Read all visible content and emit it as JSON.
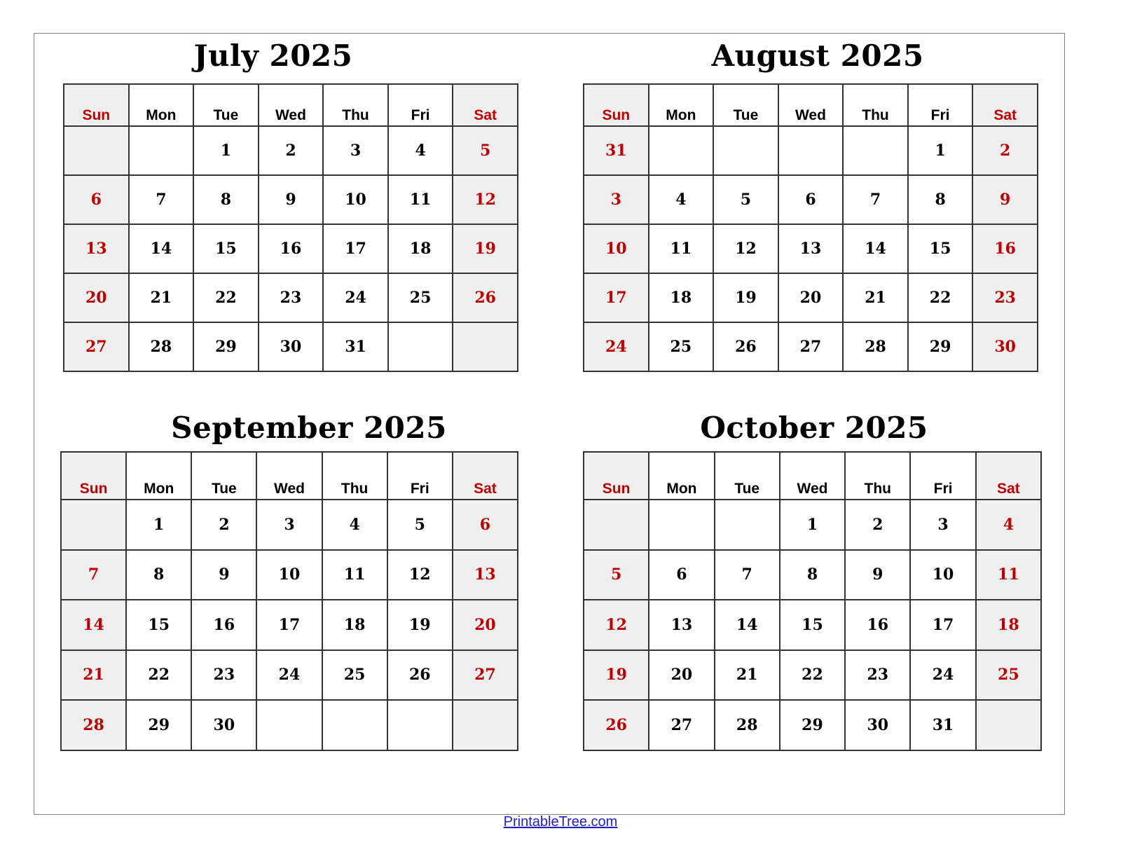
{
  "weekday_headers": [
    "Sun",
    "Mon",
    "Tue",
    "Wed",
    "Thu",
    "Fri",
    "Sat"
  ],
  "colors": {
    "weekend_text": "#c00000",
    "weekend_bg": "#efefef",
    "grid": "#333333",
    "link": "#1f1fcc"
  },
  "months": [
    {
      "title": "July 2025",
      "weeks": [
        [
          "",
          "",
          "1",
          "2",
          "3",
          "4",
          "5"
        ],
        [
          "6",
          "7",
          "8",
          "9",
          "10",
          "11",
          "12"
        ],
        [
          "13",
          "14",
          "15",
          "16",
          "17",
          "18",
          "19"
        ],
        [
          "20",
          "21",
          "22",
          "23",
          "24",
          "25",
          "26"
        ],
        [
          "27",
          "28",
          "29",
          "30",
          "31",
          "",
          ""
        ]
      ]
    },
    {
      "title": "August 2025",
      "weeks": [
        [
          "31",
          "",
          "",
          "",
          "",
          "1",
          "2"
        ],
        [
          "3",
          "4",
          "5",
          "6",
          "7",
          "8",
          "9"
        ],
        [
          "10",
          "11",
          "12",
          "13",
          "14",
          "15",
          "16"
        ],
        [
          "17",
          "18",
          "19",
          "20",
          "21",
          "22",
          "23"
        ],
        [
          "24",
          "25",
          "26",
          "27",
          "28",
          "29",
          "30"
        ]
      ]
    },
    {
      "title": "September 2025",
      "weeks": [
        [
          "",
          "1",
          "2",
          "3",
          "4",
          "5",
          "6"
        ],
        [
          "7",
          "8",
          "9",
          "10",
          "11",
          "12",
          "13"
        ],
        [
          "14",
          "15",
          "16",
          "17",
          "18",
          "19",
          "20"
        ],
        [
          "21",
          "22",
          "23",
          "24",
          "25",
          "26",
          "27"
        ],
        [
          "28",
          "29",
          "30",
          "",
          "",
          "",
          ""
        ]
      ]
    },
    {
      "title": "October 2025",
      "weeks": [
        [
          "",
          "",
          "",
          "1",
          "2",
          "3",
          "4"
        ],
        [
          "5",
          "6",
          "7",
          "8",
          "9",
          "10",
          "11"
        ],
        [
          "12",
          "13",
          "14",
          "15",
          "16",
          "17",
          "18"
        ],
        [
          "19",
          "20",
          "21",
          "22",
          "23",
          "24",
          "25"
        ],
        [
          "26",
          "27",
          "28",
          "29",
          "30",
          "31",
          ""
        ]
      ]
    }
  ],
  "footer": {
    "link_text": "PrintableTree.com"
  }
}
